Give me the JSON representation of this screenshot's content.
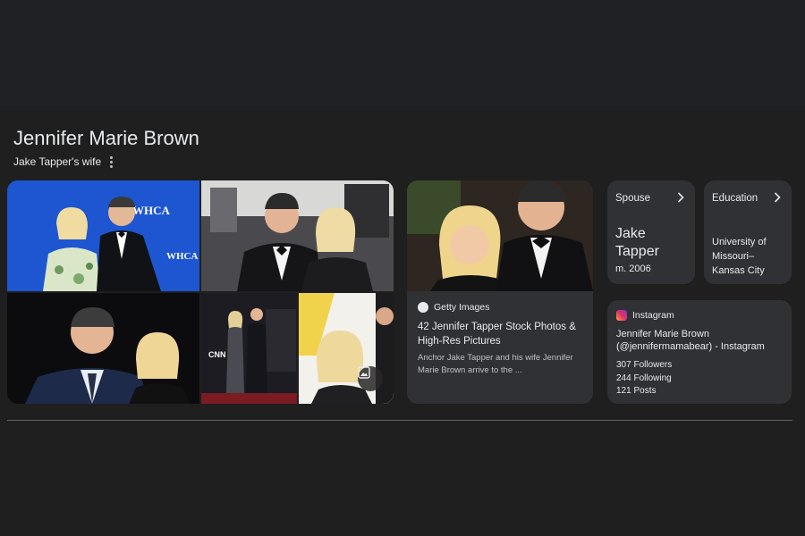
{
  "header": {
    "title": "Jennifer Marie Brown",
    "subtitle": "Jake Tapper's wife"
  },
  "collage": {
    "tiles": [
      {
        "backdrop_text": "WHCA"
      },
      {},
      {},
      {
        "backdrop_text": "CNN"
      },
      {}
    ],
    "secondary_backdrop": "WHCA"
  },
  "getty": {
    "source": "Getty Images",
    "title": "42 Jennifer Tapper Stock Photos & High-Res Pictures",
    "description": "Anchor Jake Tapper and his wife Jennifer Marie Brown arrive to the ..."
  },
  "spouse": {
    "label": "Spouse",
    "name": "Jake Tapper",
    "note": "m. 2006"
  },
  "education": {
    "label": "Education",
    "value": "University of Missouri–Kansas City"
  },
  "instagram": {
    "source": "Instagram",
    "title": "Jennifer Marie Brown (@jennifermamabear) - Instagram",
    "followers": "307 Followers",
    "following": "244 Following",
    "posts": "121 Posts"
  },
  "colors": {
    "page_bg": "#202124",
    "card_bg": "#303134",
    "text": "#e8eaed",
    "muted": "#bdc1c6",
    "whca_blue": "#1a4fc4"
  }
}
